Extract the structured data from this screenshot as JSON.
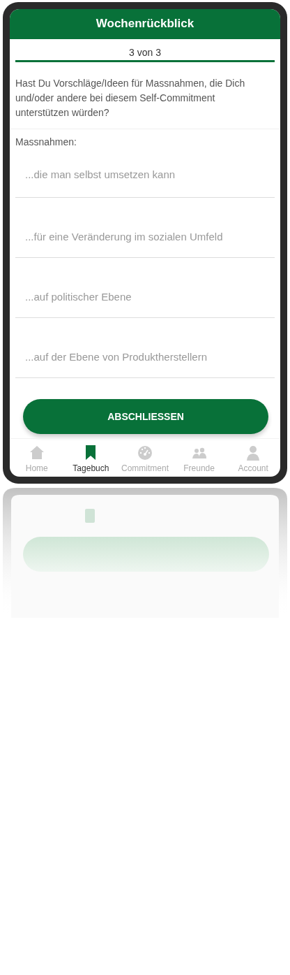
{
  "header": {
    "title": "Wochenrückblick"
  },
  "progress": {
    "label": "3 von 3",
    "level": 1
  },
  "question": "Hast Du Vorschläge/Ideen für Massnahmen, die Dich und/oder andere bei diesem Self-Commitment unterstützen würden?",
  "section_label": "Massnahmen:",
  "fields": [
    {
      "placeholder": "...die man selbst umsetzen kann"
    },
    {
      "placeholder": "...für eine Veränderung im sozialen Umfeld"
    },
    {
      "placeholder": "...auf politischer Ebene"
    },
    {
      "placeholder": "...auf der Ebene von Produktherstellern"
    }
  ],
  "button": "ABSCHLIESSEN",
  "tabs": [
    {
      "label": "Home",
      "kind": "home",
      "selected": false
    },
    {
      "label": "Tagebuch",
      "kind": "bookmark",
      "selected": true
    },
    {
      "label": "Commitment",
      "kind": "gauge",
      "selected": false
    },
    {
      "label": "Freunde",
      "kind": "people",
      "selected": false
    },
    {
      "label": "Account",
      "kind": "person",
      "selected": false
    }
  ]
}
